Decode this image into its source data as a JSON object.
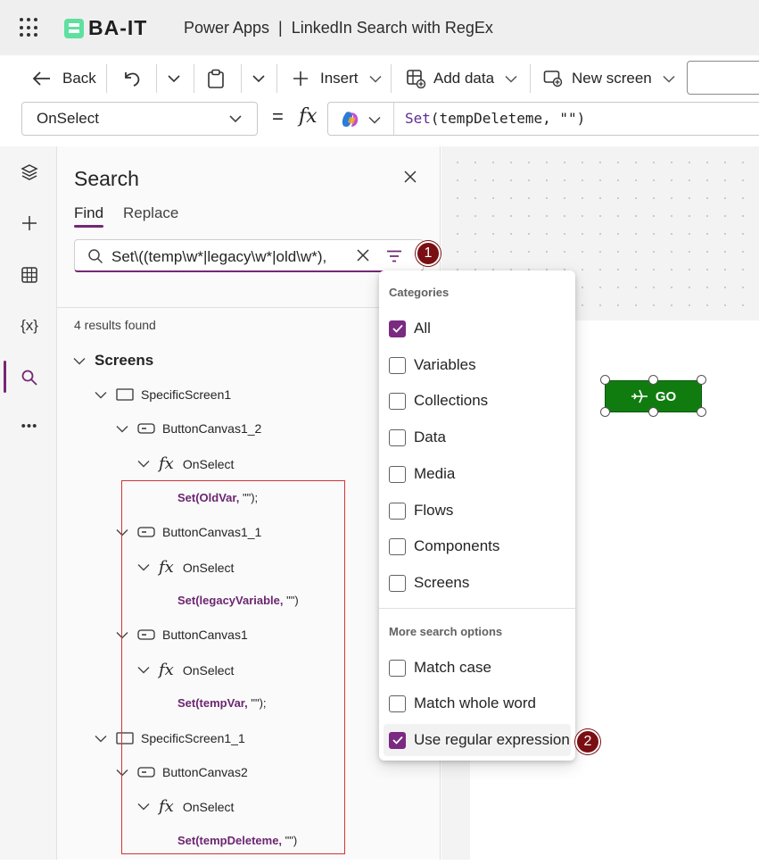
{
  "titlebar": {
    "brand": "BA-IT",
    "title": "Power Apps  |  LinkedIn Search with RegEx"
  },
  "commandbar": {
    "back_label": "Back",
    "insert_label": "Insert",
    "add_data_label": "Add data",
    "new_screen_label": "New screen"
  },
  "formula": {
    "property": "OnSelect",
    "equals": "=",
    "fx": "fx",
    "fn_name": "Set",
    "expression_rest": "(tempDeleteme, \"\")"
  },
  "rail": {
    "variables_label": "{x}",
    "more_label": "•••"
  },
  "search_panel": {
    "title": "Search",
    "tabs": {
      "find": "Find",
      "replace": "Replace"
    },
    "query": "Set\\((temp\\w*|legacy\\w*|old\\w*),",
    "results_count": "4 results found",
    "tree": {
      "screens_label": "Screens",
      "screen1": "SpecificScreen1",
      "btn1_2": "ButtonCanvas1_2",
      "onselect": "OnSelect",
      "fx": "fx",
      "r1_match": "Set(OldVar,",
      "r1_rest": " \"\");",
      "btn1_1": "ButtonCanvas1_1",
      "r2_match": "Set(legacyVariable,",
      "r2_rest": " \"\")",
      "btn1": "ButtonCanvas1",
      "r3_match": "Set(tempVar,",
      "r3_rest": " \"\");",
      "screen2": "SpecificScreen1_1",
      "btn2": "ButtonCanvas2",
      "r4_match": "Set(tempDeleteme,",
      "r4_rest": " \"\")"
    }
  },
  "canvas": {
    "go_label": "GO",
    "go_color": "#107c10"
  },
  "dropdown": {
    "categories_header": "Categories",
    "items": {
      "all": "All",
      "variables": "Variables",
      "collections": "Collections",
      "data": "Data",
      "media": "Media",
      "flows": "Flows",
      "components": "Components",
      "screens": "Screens"
    },
    "more_header": "More search options",
    "options": {
      "match_case": "Match case",
      "match_whole_word": "Match whole word",
      "use_regex": "Use regular expression"
    }
  },
  "badges": {
    "one": "1",
    "two": "2"
  },
  "accent": "#742774"
}
